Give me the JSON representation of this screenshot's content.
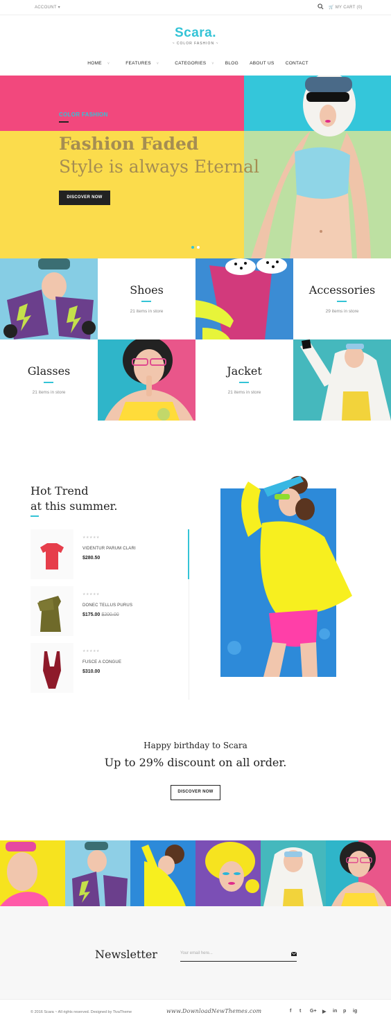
{
  "topbar": {
    "account": "ACCOUNT ▾",
    "cart": "MY CART (0)"
  },
  "brand": {
    "logo": "Scara.",
    "tagline": "~ COLOR FASHION ~",
    "accent": "#33c3d6"
  },
  "nav": [
    "HOME",
    "FEATURES",
    "CATEGORIES",
    "BLOG",
    "ABOUT US",
    "CONTACT"
  ],
  "hero": {
    "eyebrow": "COLOR FASHION",
    "title1": "Fashion Faded",
    "title2": "Style is always Eternal",
    "button": "DISCOVER NOW"
  },
  "categories": [
    {
      "name": "Shoes",
      "count": "21 items in store"
    },
    {
      "name": "Accessories",
      "count": "29 items in store"
    },
    {
      "name": "Glasses",
      "count": "21 items in store"
    },
    {
      "name": "Jacket",
      "count": "21 items in store"
    }
  ],
  "hot": {
    "title1": "Hot Trend",
    "title2": "at this summer.",
    "products": [
      {
        "stars": "★★★★★",
        "name": "VIDENTUR PARUM CLARI",
        "price": "$280.50",
        "old": ""
      },
      {
        "stars": "★★★★★",
        "name": "DONEC TELLUS PURUS",
        "price": "$175.00",
        "old": "$200.00"
      },
      {
        "stars": "★★★★★",
        "name": "FUSCE A CONGUE",
        "price": "$310.00",
        "old": ""
      }
    ]
  },
  "promo": {
    "sub": "Happy birthday to Scara",
    "main": "Up to 29% discount on all order.",
    "button": "DISCOVER NOW"
  },
  "newsletter": {
    "title": "Newsletter",
    "placeholder": "Your email here..."
  },
  "footer": {
    "copyright": "© 2016 Scara ~ All rights reserved. Designed by TivaTheme",
    "watermark": "www.DownloadNewThemes.com",
    "social": [
      "f",
      "t",
      "G+",
      "▶",
      "in",
      "p",
      "ig"
    ]
  }
}
